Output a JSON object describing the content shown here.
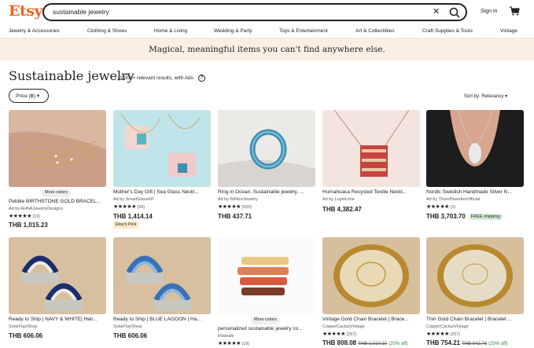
{
  "header": {
    "logo": "Etsy",
    "search_value": "sustainable jewelry",
    "clear_glyph": "✕",
    "signin_label": "Sign in"
  },
  "nav": {
    "categories": [
      "Jewelry & Accessories",
      "Clothing & Shoes",
      "Home & Living",
      "Wedding & Party",
      "Toys & Entertainment",
      "Art & Collectibles",
      "Craft Supplies & Tools",
      "Vintage"
    ]
  },
  "banner": {
    "text": "Magical, meaningful items you can't find anywhere else."
  },
  "page": {
    "title": "Sustainable jewelry",
    "results": "(1,000+ relevant results, with Ads",
    "info_glyph": "?",
    "price_filter": "Price (฿) ▾",
    "sort": "Sort by: Relevancy ▾"
  },
  "colors": {
    "brand": "#f1641e",
    "banner_bg": "#fbeee5",
    "pick_badge": "#fde8c8",
    "ship_badge": "#d4e9d7",
    "discount": "#258635"
  },
  "listings": [
    {
      "title": "Pebble BIRTHSTONE GOLD BRACEL...",
      "shop": "Ad by AHNAJewelryDesigns",
      "stars": "★★★★★",
      "reviews": "(16)",
      "price": "THB 1,015.23",
      "more_colors": "More colors"
    },
    {
      "title": "Mother's Day Gift | Sea Glass Neckl...",
      "shop": "Ad by SmartGlassKP",
      "stars": "★★★★★",
      "reviews": "(99)",
      "price": "THB 1,414.14",
      "badge": "Etsy's Pick"
    },
    {
      "title": "Ring in Ocean, Sustainable jewelry, ...",
      "shop": "Ad by NINIcoJewelry",
      "stars": "★★★★★",
      "reviews": "(505)",
      "price": "THB 437.71"
    },
    {
      "title": "Humahuaca Recycled Textile Neckl...",
      "shop": "Ad by LupinLime",
      "price": "THB 4,382.47"
    },
    {
      "title": "Nordic Swedish Handmade Silver N...",
      "shop": "Ad by ThorofSwedenOfficial",
      "stars": "★★★★★",
      "reviews": "(3)",
      "price": "THB 3,703.70",
      "shipping": "FREE shipping"
    },
    {
      "title": "Ready to Ship | NAVY & WHITE| Han...",
      "shop": "SolarFlairShop",
      "price": "THB 606.06"
    },
    {
      "title": "Ready to Ship | BLUE LAGOON | Ha...",
      "shop": "SolarFlairShop",
      "price": "THB 606.06"
    },
    {
      "title": "personalized sustainable jewelry co...",
      "shop": "khaleafs",
      "stars": "★★★★★",
      "reviews": "(19)",
      "more_colors": "More colors"
    },
    {
      "title": "Vintage Gold Chain Bracelet | Brace...",
      "shop": "CopperCactusVintage",
      "stars": "★★★★★",
      "reviews": "(257)",
      "price": "THB 808.08",
      "orig_price": "THB 1,010.10",
      "discount": "(20% off)"
    },
    {
      "title": "Thin Gold Chain Bracelet | Bracelet ...",
      "shop": "CopperCactusVintage",
      "stars": "★★★★★",
      "reviews": "(257)",
      "price": "THB 754.21",
      "orig_price": "THB 942.76",
      "discount": "(20% off)"
    }
  ]
}
